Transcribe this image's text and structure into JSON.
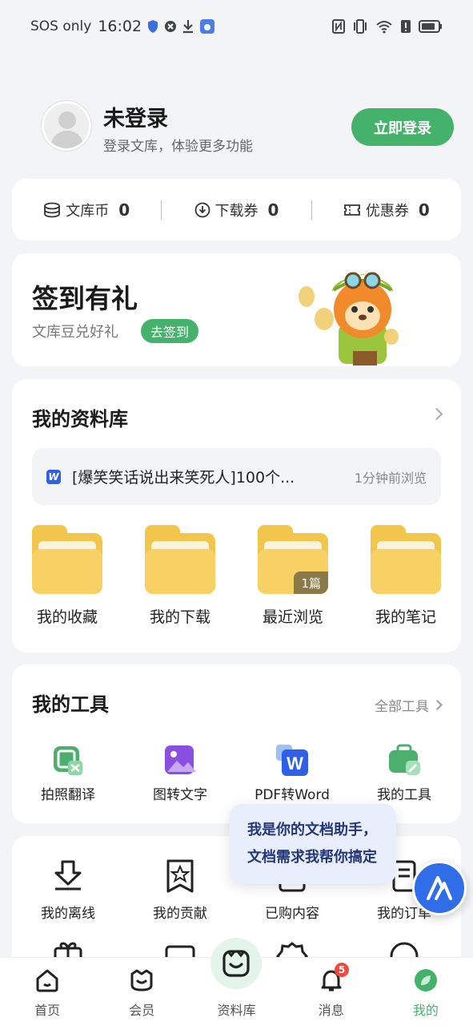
{
  "status_bar": {
    "carrier": "SOS only",
    "time": "16:02"
  },
  "profile": {
    "name": "未登录",
    "subtitle": "登录文库，体验更多功能",
    "login_label": "立即登录"
  },
  "stats": [
    {
      "label": "文库币",
      "value": "0",
      "icon": "coin-stack-icon"
    },
    {
      "label": "下载券",
      "value": "0",
      "icon": "download-circle-icon"
    },
    {
      "label": "优惠券",
      "value": "0",
      "icon": "ticket-icon"
    }
  ],
  "signin": {
    "title": "签到有礼",
    "subtitle": "文库豆兑好礼",
    "button": "去签到"
  },
  "library": {
    "title": "我的资料库",
    "recent": {
      "badge": "W",
      "title": "[爆笑笑话说出来笑死人]100个...",
      "time": "1分钟前浏览"
    },
    "folders": [
      {
        "label": "我的收藏",
        "count": ""
      },
      {
        "label": "我的下载",
        "count": ""
      },
      {
        "label": "最近浏览",
        "count": "1篇"
      },
      {
        "label": "我的笔记",
        "count": ""
      }
    ]
  },
  "tools": {
    "title": "我的工具",
    "all_label": "全部工具",
    "items": [
      {
        "label": "拍照翻译",
        "icon": "photo-translate-icon"
      },
      {
        "label": "图转文字",
        "icon": "image-to-text-icon"
      },
      {
        "label": "PDF转Word",
        "icon": "pdf-to-word-icon"
      },
      {
        "label": "我的工具",
        "icon": "toolbox-icon"
      }
    ]
  },
  "more": {
    "items": [
      {
        "label": "我的离线",
        "icon": "offline-download-icon"
      },
      {
        "label": "我的贡献",
        "icon": "contribution-star-icon"
      },
      {
        "label": "已购内容",
        "icon": "purchased-icon"
      },
      {
        "label": "我的订单",
        "icon": "order-list-icon"
      }
    ]
  },
  "assistant": {
    "line1": "我是你的文档助手，",
    "line2": "文档需求我帮你搞定"
  },
  "tabbar": {
    "items": [
      {
        "label": "首页",
        "icon": "home-icon"
      },
      {
        "label": "会员",
        "icon": "vip-icon"
      },
      {
        "label": "资料库",
        "icon": "library-icon"
      },
      {
        "label": "消息",
        "icon": "bell-icon"
      },
      {
        "label": "我的",
        "icon": "profile-leaf-icon"
      }
    ],
    "message_badge": "5"
  },
  "colors": {
    "accent": "#45b26b",
    "folder": "#f7d163",
    "assistant_blue": "#2f6ee8"
  }
}
